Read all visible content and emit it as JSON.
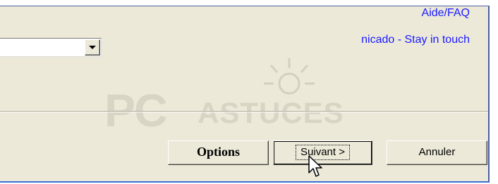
{
  "links": {
    "help": "Aide/FAQ",
    "stay_in_touch": "nicado - Stay in touch"
  },
  "combo": {
    "value": ""
  },
  "watermark": {
    "brand_left": "PC",
    "brand_right": "ASTUCES"
  },
  "buttons": {
    "options": "Options",
    "next": "Suivant >",
    "cancel": "Annuler"
  },
  "colors": {
    "window": "#ece9d8",
    "link": "#1a1aff",
    "frame": "#4a5ea6"
  },
  "icons": {
    "combo_arrow": "chevron-down-icon",
    "cursor": "mouse-pointer-icon"
  }
}
